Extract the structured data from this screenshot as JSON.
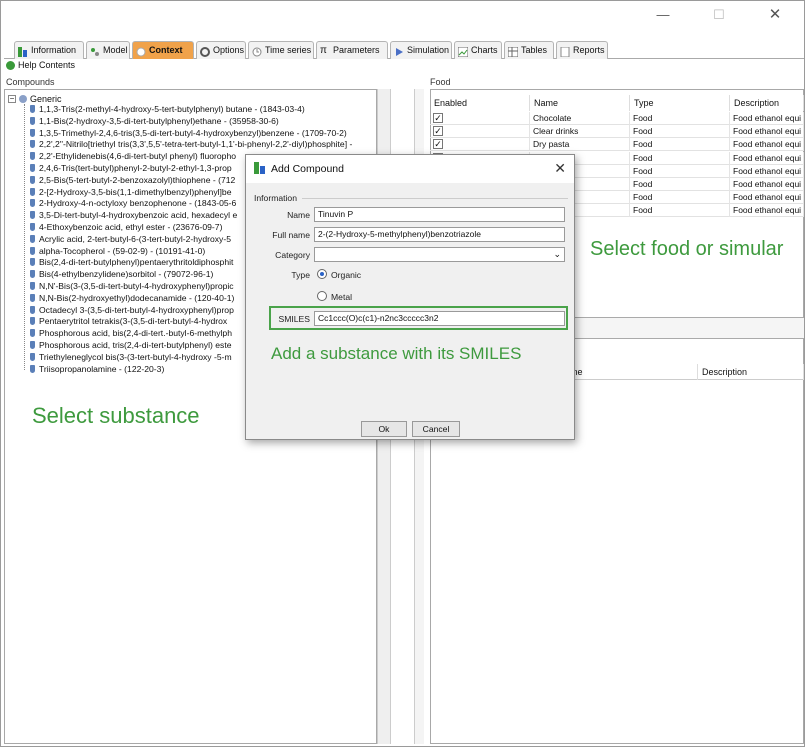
{
  "window": {
    "minimize_icon": "minimize-icon",
    "maximize_icon": "maximize-icon",
    "close_icon": "close-icon",
    "min": "—",
    "max": "☐",
    "close": "✕"
  },
  "tabs": [
    {
      "label": "Information"
    },
    {
      "label": "Model"
    },
    {
      "label": "Context",
      "active": true
    },
    {
      "label": "Options"
    },
    {
      "label": "Time series"
    },
    {
      "label": "Parameters"
    },
    {
      "label": "Simulation"
    },
    {
      "label": "Charts"
    },
    {
      "label": "Tables"
    },
    {
      "label": "Reports"
    }
  ],
  "help": {
    "label": "Help Contents"
  },
  "compounds": {
    "group_label": "Compounds",
    "root": "Generic",
    "items": [
      "1,1,3-Tris(2-methyl-4-hydroxy-5-tert-butylphenyl) butane - (1843-03-4)",
      "1,1-Bis(2-hydroxy-3,5-di-tert-butylphenyl)ethane - (35958-30-6)",
      "1,3,5-Trimethyl-2,4,6-tris(3,5-di-tert-butyl-4-hydroxybenzyl)benzene - (1709-70-2)",
      "2,2',2''-Nitrilo[triethyl tris(3,3',5,5'-tetra-tert-butyl-1,1'-bi-phenyl-2,2'-diyl)phosphite] -",
      "2,2'-Ethylidenebis(4,6-di-tert-butyl phenyl) fluoropho",
      "2,4,6-Tris(tert-butyl)phenyl-2-butyl-2-ethyl-1,3-prop",
      "2,5-Bis(5-tert-butyl-2-benzoxazolyl)thiophene - (712",
      "2-[2-Hydroxy-3,5-bis(1,1-dimethylbenzyl)phenyl]be",
      "2-Hydroxy-4-n-octyloxy benzophenone - (1843-05-6",
      "3,5-Di-tert-butyl-4-hydroxybenzoic acid, hexadecyl e",
      "4-Ethoxybenzoic acid, ethyl ester - (23676-09-7)",
      "Acrylic acid, 2-tert-butyl-6-(3-tert-butyl-2-hydroxy-5",
      "alpha-Tocopherol - (59-02-9) - (10191-41-0)",
      "Bis(2,4-di-tert-butylphenyl)pentaerythritoldiphosphit",
      "Bis(4-ethylbenzylidene)sorbitol - (79072-96-1)",
      "N,N'-Bis(3-(3,5-di-tert-butyl-4-hydroxyphenyl)propic",
      "N,N-Bis(2-hydroxyethyl)dodecanamide - (120-40-1)",
      "Octadecyl 3-(3,5-di-tert-butyl-4-hydroxyphenyl)prop",
      "Pentaerytritol tetrakis(3-(3,5-di-tert-butyl-4-hydrox",
      "Phosphorous acid, bis(2,4-di-tert.-butyl-6-methylph",
      "Phosphorous acid, tris(2,4-di-tert-butylphenyl) este",
      "Triethyleneglycol bis(3-(3-tert-butyl-4-hydroxy -5-m",
      "Triisopropanolamine - (122-20-3)"
    ]
  },
  "food": {
    "group_label": "Food",
    "columns": [
      "Enabled",
      "Name",
      "Type",
      "Description"
    ],
    "rows": [
      {
        "enabled": true,
        "name": "Chocolate",
        "type": "Food",
        "description": "Food ethanol equi"
      },
      {
        "enabled": true,
        "name": "Clear drinks",
        "type": "Food",
        "description": "Food ethanol equi"
      },
      {
        "enabled": true,
        "name": "Dry pasta",
        "type": "Food",
        "description": "Food ethanol equi"
      },
      {
        "enabled": true,
        "name": "",
        "type": "Food",
        "description": "Food ethanol equi"
      },
      {
        "enabled": true,
        "name": "",
        "type": "Food",
        "description": "Food ethanol equi"
      },
      {
        "enabled": true,
        "name": "ce",
        "type": "Food",
        "description": "Food ethanol equi"
      },
      {
        "enabled": true,
        "name": "uce",
        "type": "Food",
        "description": "Food ethanol equi"
      },
      {
        "enabled": true,
        "name": "",
        "type": "Food",
        "description": "Food ethanol equi"
      }
    ],
    "second_columns": [
      "ame",
      "Description"
    ]
  },
  "annotations": {
    "select_substance": "Select substance",
    "select_food": "Select food or simular",
    "add_smiles": "Add a substance with its SMILES"
  },
  "dialog": {
    "title": "Add Compound",
    "section": "Information",
    "name_label": "Name",
    "name_value": "Tinuvin P",
    "fullname_label": "Full name",
    "fullname_value": "2-(2-Hydroxy-5-methylphenyl)benzotriazole",
    "category_label": "Category",
    "category_value": "",
    "type_label": "Type",
    "type_organic": "Organic",
    "type_metal": "Metal",
    "selected_type": "Organic",
    "smiles_label": "SMILES",
    "smiles_value": "Cc1ccc(O)c(c1)-n2nc3ccccc3n2",
    "ok": "Ok",
    "cancel": "Cancel"
  },
  "colors": {
    "accent": "#f0a24a",
    "annotation": "#3e9a3e",
    "smiles_border": "#4aa34a"
  }
}
